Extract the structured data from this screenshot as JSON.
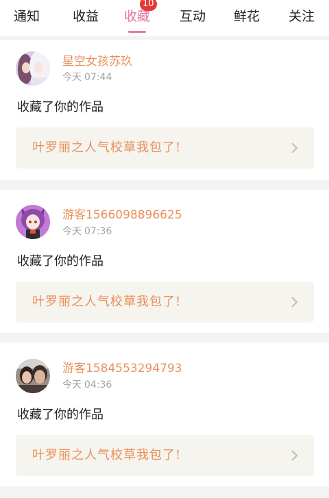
{
  "tabs": [
    {
      "label": "通知"
    },
    {
      "label": "收益"
    },
    {
      "label": "收藏",
      "badge": "10",
      "active": true
    },
    {
      "label": "互动"
    },
    {
      "label": "鲜花"
    },
    {
      "label": "关注"
    }
  ],
  "notifications": [
    {
      "user_name": "星空女孩苏玖",
      "date_label": "今天",
      "time": "07:44",
      "action": "收藏了你的作品",
      "work_title": "叶罗丽之人气校草我包了!"
    },
    {
      "user_prefix": "游客",
      "user_digits": "1566098896625",
      "date_label": "今天",
      "time": "07:36",
      "action": "收藏了你的作品",
      "work_title": "叶罗丽之人气校草我包了!"
    },
    {
      "user_prefix": "游客",
      "user_digits": "1584553294793",
      "date_label": "今天",
      "time": "04:36",
      "action": "收藏了你的作品",
      "work_title": "叶罗丽之人气校草我包了!"
    }
  ],
  "colors": {
    "accent": "#e2789f",
    "badge": "#e53935",
    "name": "#e9905b",
    "meta": "#a3a3a3"
  },
  "icons": {
    "chevron": "chevron-right-icon"
  }
}
